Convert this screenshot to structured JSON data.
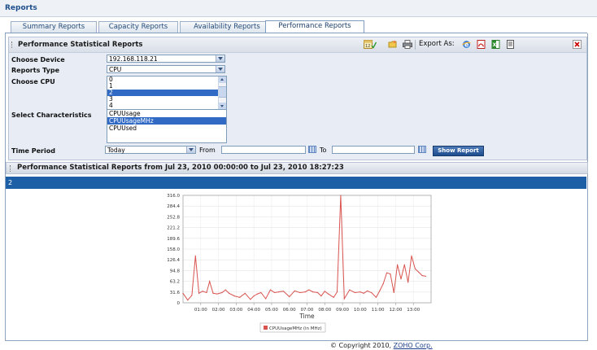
{
  "header": {
    "title": "Reports"
  },
  "tabs": [
    {
      "label": "Summary Reports",
      "active": false
    },
    {
      "label": "Capacity Reports",
      "active": false
    },
    {
      "label": "Availability Reports",
      "active": false
    },
    {
      "label": "Performance Reports",
      "active": true
    }
  ],
  "panel": {
    "title": "Performance Statistical Reports",
    "export_label": "Export As:",
    "toolbar_icons": [
      "schedule-icon",
      "folder-icon",
      "print-icon"
    ],
    "export_icons": [
      "ie-export-icon",
      "pdf-export-icon",
      "excel-export-icon",
      "csv-export-icon"
    ],
    "close_icon": "close-icon"
  },
  "form": {
    "device_label": "Choose Device",
    "device_value": "192.168.118.21",
    "reports_type_label": "Reports Type",
    "reports_type_value": "CPU",
    "cpu_label": "Choose CPU",
    "cpu_options": [
      "0",
      "1",
      "2",
      "3",
      "4"
    ],
    "cpu_selected": "2",
    "characteristics_label": "Select Characteristics",
    "characteristics_options": [
      "CPUUsage",
      "CPUUsageMHz",
      "CPUUsed"
    ],
    "characteristics_selected": "CPUUsageMHz",
    "time_period_label": "Time Period",
    "time_period_value": "Today",
    "from_label": "From",
    "from_value": "",
    "to_label": "To",
    "to_value": "",
    "show_report_label": "Show Report"
  },
  "results": {
    "title": "Performance Statistical Reports from Jul 23, 2010 00:00:00 to Jul 23, 2010 18:27:23",
    "cpu_header": "2"
  },
  "chart_data": {
    "type": "line",
    "title": "",
    "xlabel": "Time",
    "ylabel": "",
    "ylim": [
      0,
      316.0
    ],
    "xlim": [
      "00:00",
      "14:00"
    ],
    "yticks": [
      "0",
      "31.6",
      "63.2",
      "94.8",
      "126.4",
      "158.0",
      "189.6",
      "221.2",
      "252.8",
      "284.4",
      "316.0"
    ],
    "xticks": [
      "01:00",
      "02:00",
      "03:00",
      "04:00",
      "05:00",
      "06:00",
      "07:00",
      "08:00",
      "09:00",
      "10:00",
      "11:00",
      "12:00",
      "13:00"
    ],
    "grid": true,
    "legend": "bottom",
    "colors": {
      "series": "#d9534f"
    },
    "series": [
      {
        "name": "CPUUsageMHz (in MHz)",
        "x": [
          "00:00",
          "00:16",
          "00:30",
          "00:42",
          "00:54",
          "01:06",
          "01:20",
          "01:30",
          "01:42",
          "01:56",
          "02:12",
          "02:24",
          "02:36",
          "02:54",
          "03:12",
          "03:30",
          "03:48",
          "04:00",
          "04:12",
          "04:24",
          "04:40",
          "04:56",
          "05:10",
          "05:24",
          "05:40",
          "06:00",
          "06:18",
          "06:36",
          "06:54",
          "07:06",
          "07:20",
          "07:36",
          "07:48",
          "08:00",
          "08:12",
          "08:30",
          "08:42",
          "08:54",
          "09:06",
          "09:24",
          "09:42",
          "10:00",
          "10:12",
          "10:24",
          "10:38",
          "10:54",
          "11:06",
          "11:18",
          "11:30",
          "11:42",
          "11:54",
          "12:06",
          "12:18",
          "12:30",
          "12:42",
          "12:54",
          "13:06",
          "13:18",
          "13:30",
          "13:42"
        ],
        "values": [
          28,
          8,
          22,
          138,
          28,
          34,
          30,
          63,
          28,
          26,
          30,
          38,
          28,
          20,
          16,
          28,
          10,
          20,
          26,
          30,
          12,
          38,
          30,
          32,
          34,
          18,
          35,
          30,
          32,
          38,
          32,
          30,
          20,
          34,
          26,
          16,
          32,
          316,
          12,
          38,
          30,
          32,
          28,
          35,
          30,
          16,
          35,
          56,
          88,
          85,
          30,
          112,
          70,
          112,
          60,
          138,
          100,
          90,
          80,
          78
        ]
      }
    ]
  },
  "footer": {
    "copyright_text": "© Copyright 2010,",
    "company": "ZOHO Corp."
  }
}
